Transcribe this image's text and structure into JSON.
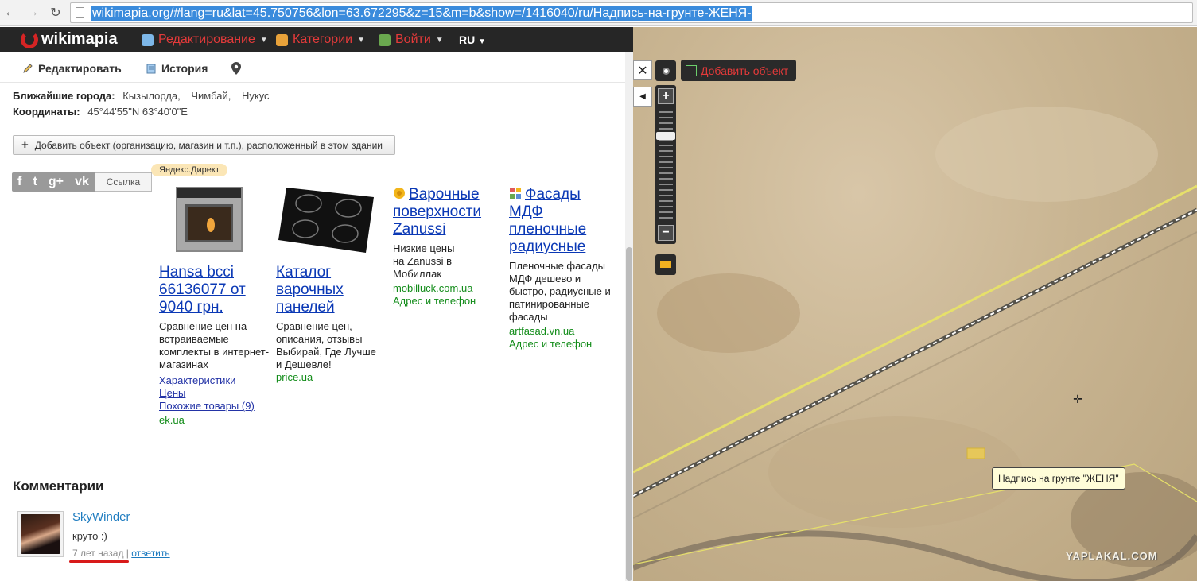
{
  "browser": {
    "url": "wikimapia.org/#lang=ru&lat=45.750756&lon=63.672295&z=15&m=b&show=/1416040/ru/Надпись-на-грунте-ЖЕНЯ-"
  },
  "wm_header": {
    "logo": "wikimapia",
    "edit": "Редактирование",
    "categories": "Категории",
    "login": "Войти",
    "lang": "RU"
  },
  "toolbar": {
    "edit": "Редактировать",
    "history": "История"
  },
  "info": {
    "cities_label": "Ближайшие города:",
    "cities": [
      "Кызылорда,",
      "Чимбай,",
      "Нукус"
    ],
    "coords_label": "Координаты:",
    "coords": "45°44'55\"N 63°40'0\"E"
  },
  "add_object": "Добавить объект (организацию, магазин и т.п.), расположенный в этом здании",
  "share": {
    "link_label": "Ссылка"
  },
  "yandex_label": "Яндекс.Директ",
  "ads": [
    {
      "title": "Hansa bcci 66136077 от 9040 грн.",
      "desc": "Сравнение цен на встраиваемые комплекты в интернет-магазинах",
      "links": [
        "Характеристики",
        "Цены",
        "Похожие товары (9)"
      ],
      "domain": "ek.ua",
      "extra": ""
    },
    {
      "title": "Каталог варочных панелей",
      "desc": "Сравнение цен, описания, отзывы Выбирай, Где Лучше и Дешевле!",
      "links": [],
      "domain": "price.ua",
      "extra": ""
    },
    {
      "title": "Варочные поверхности Zanussi",
      "desc": "Низкие цены на Zanussi в Мобиллак",
      "links": [],
      "domain": "mobilluck.com.ua",
      "extra": "Адрес и телефон"
    },
    {
      "title": "Фасады МДФ пленочные радиусные",
      "desc": "Пленочные фасады МДФ дешево и быстро, радиусные и патинированные фасады",
      "links": [],
      "domain": "artfasad.vn.ua",
      "extra": "Адрес и телефон"
    }
  ],
  "comments": {
    "heading": "Комментарии",
    "items": [
      {
        "user": "SkyWinder",
        "text": "круто :)",
        "time": "7 лет назад",
        "reply": "ответить"
      }
    ]
  },
  "map": {
    "add_object": "Добавить объект",
    "tooltip": "Надпись на грунте \"ЖЕНЯ\"",
    "watermark": "YAPLAKAL.COM",
    "close_symbol": "✕",
    "zoom_in": "+",
    "zoom_out": "−"
  }
}
